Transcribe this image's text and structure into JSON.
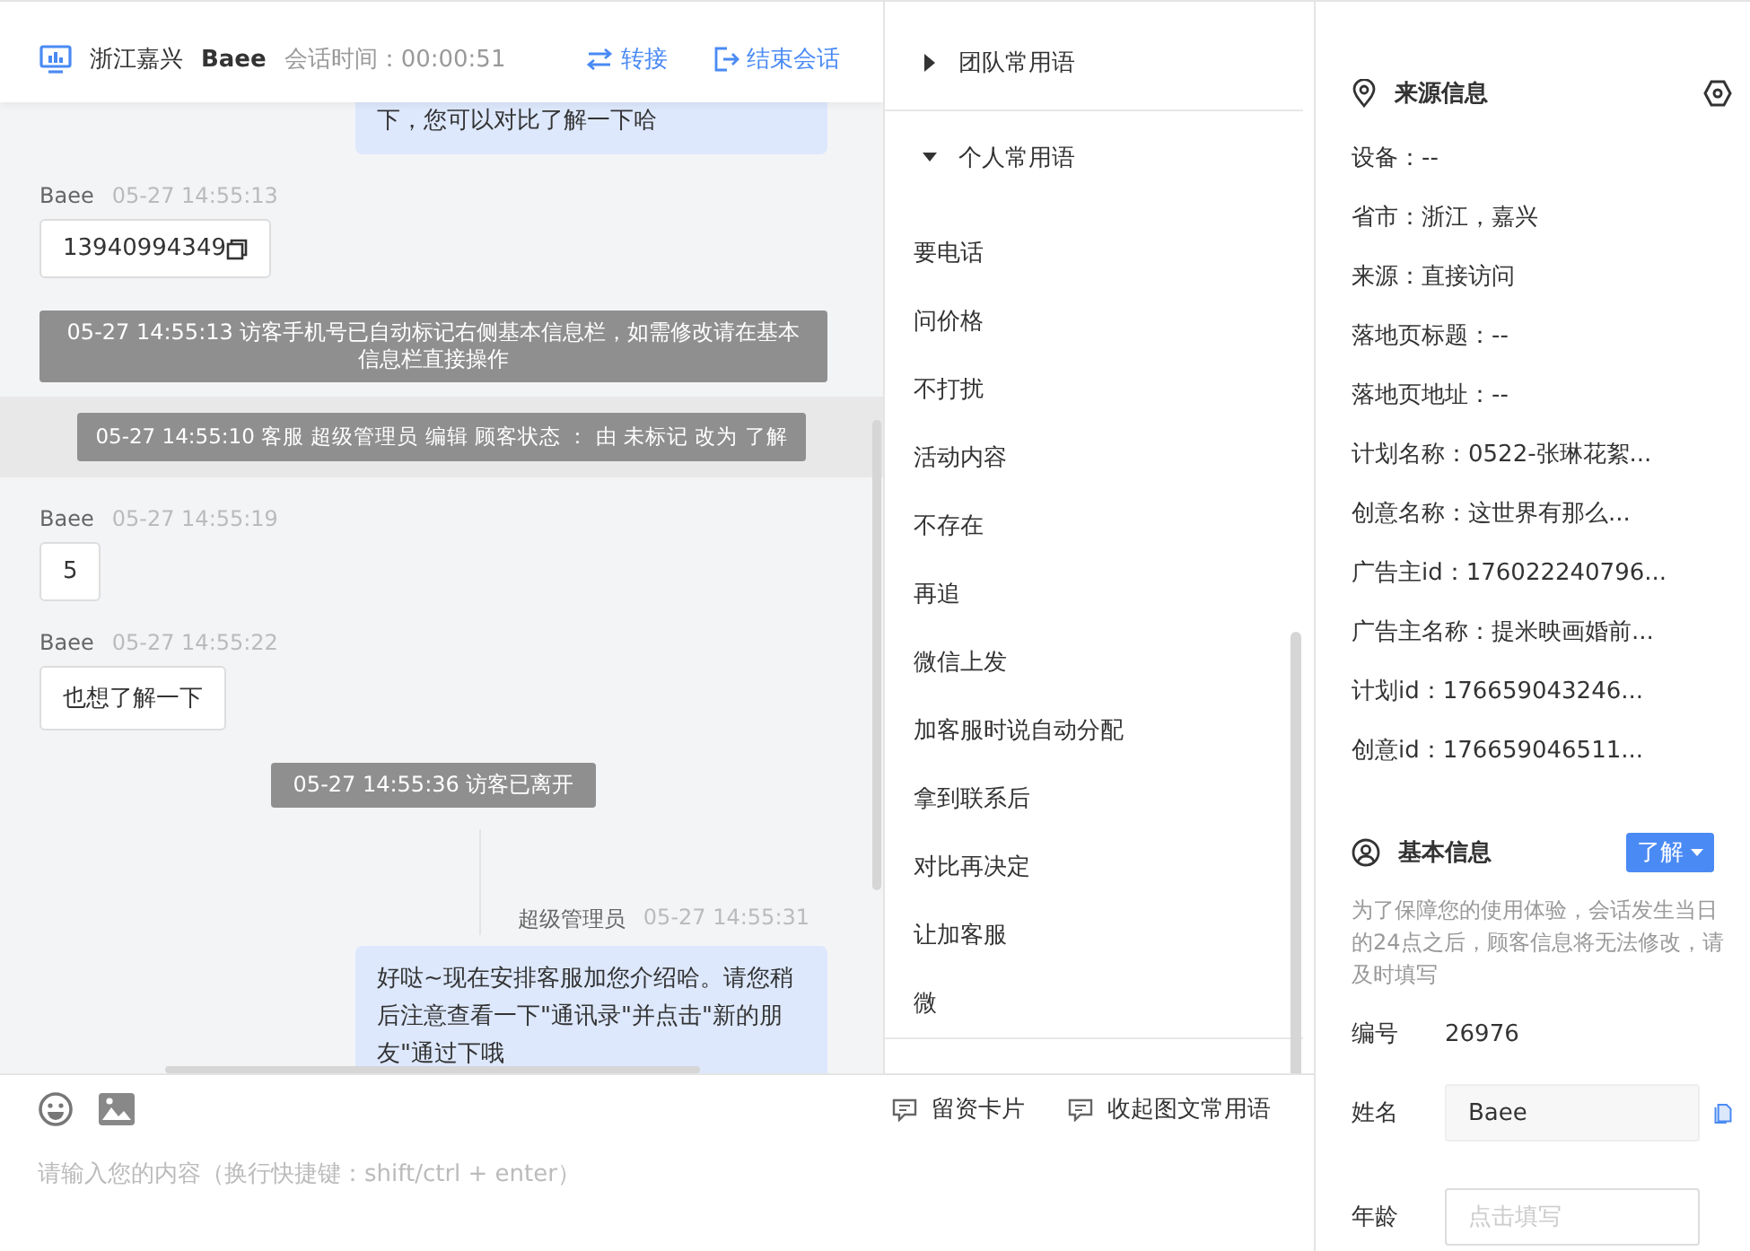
{
  "chat_header": {
    "location": "浙江嘉兴",
    "visitor": "Baee",
    "duration_label": "会话时间：",
    "duration": "00:00:51",
    "actions": [
      "转接",
      "结束会话"
    ]
  },
  "messages": [
    {
      "kind": "agent",
      "text": "下，您可以对比了解一下哈"
    },
    {
      "kind": "visitor",
      "name": "Baee",
      "time": "05-27 14:55:13",
      "text": "13940994349",
      "copyable": true
    },
    {
      "kind": "system",
      "text": "05-27 14:55:13 访客手机号已自动标记右侧基本信息栏，如需修改请在基本信息栏直接操作"
    },
    {
      "kind": "status",
      "text": "05-27 14:55:10 客服 超级管理员 编辑 顾客状态 ： 由 未标记 改为 了解"
    },
    {
      "kind": "visitor",
      "name": "Baee",
      "time": "05-27 14:55:19",
      "text": "5",
      "copyable": false
    },
    {
      "kind": "visitor",
      "name": "Baee",
      "time": "05-27 14:55:22",
      "text": "也想了解一下",
      "copyable": false
    },
    {
      "kind": "system",
      "text": "05-27 14:55:36 访客已离开"
    },
    {
      "kind": "agent",
      "name": "超级管理员",
      "time": "05-27 14:55:31",
      "text": "好哒~现在安排客服加您介绍哈。请您稍后注意查看一下\"通讯录\"并点击\"新的朋友\"通过下哦"
    }
  ],
  "phrase_groups": [
    {
      "title": "团队常用语",
      "expanded": false
    },
    {
      "title": "个人常用语",
      "expanded": true,
      "items": [
        "要电话",
        "问价格",
        "不打扰",
        "活动内容",
        "不存在",
        "再追",
        "微信上发",
        "加客服时说自动分配",
        "拿到联系后",
        "对比再决定",
        "让加客服",
        "微"
      ]
    }
  ],
  "composer": {
    "actions": [
      "留资卡片",
      "收起图文常用语"
    ],
    "placeholder": "请输入您的内容（换行快捷键：shift/ctrl + enter）"
  },
  "source_info": {
    "title": "来源信息",
    "rows": [
      "设备：--",
      "省市：浙江，嘉兴",
      "来源：直接访问",
      "落地页标题：--",
      "落地页地址：--",
      "计划名称：0522-张琳花絮...",
      "创意名称：这世界有那么...",
      "广告主id：176022240796...",
      "广告主名称：提米映画婚前...",
      "计划id：176659043246...",
      "创意id：176659046511..."
    ]
  },
  "basic_info": {
    "title": "基本信息",
    "status": "了解",
    "note": "为了保障您的使用体验，会话发生当日的24点之后，顾客信息将无法修改，请及时填写",
    "fields": [
      {
        "kind": "text",
        "label": "编号",
        "value": "26976"
      },
      {
        "kind": "input",
        "label": "姓名",
        "value": "Baee",
        "copyable": true
      },
      {
        "kind": "input",
        "label": "年龄",
        "placeholder": "点击填写",
        "copyable": false
      }
    ]
  }
}
